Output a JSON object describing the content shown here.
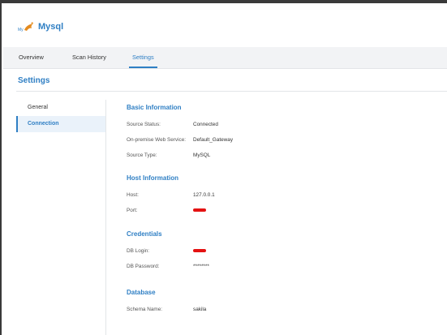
{
  "app": {
    "title": "Mysql",
    "logo_icon": "mysql-dolphin-logo-icon",
    "accent": "#2f7fc4"
  },
  "tabs": [
    {
      "label": "Overview",
      "active": false
    },
    {
      "label": "Scan History",
      "active": false
    },
    {
      "label": "Settings",
      "active": true
    }
  ],
  "page": {
    "title": "Settings"
  },
  "sidebar": {
    "items": [
      {
        "label": "General",
        "active": false
      },
      {
        "label": "Connection",
        "active": true
      }
    ]
  },
  "sections": {
    "basic": {
      "title": "Basic Information",
      "rows": [
        {
          "label": "Source Status:",
          "value": "Connected"
        },
        {
          "label": "On-premise Web Service:",
          "value": "Default_Gateway"
        },
        {
          "label": "Source Type:",
          "value": "MySQL"
        }
      ]
    },
    "host": {
      "title": "Host Information",
      "rows": [
        {
          "label": "Host:",
          "value": "127.0.0.1"
        },
        {
          "label": "Port:",
          "value": ""
        }
      ]
    },
    "credentials": {
      "title": "Credentials",
      "rows": [
        {
          "label": "DB Login:",
          "value": ""
        },
        {
          "label": "DB Password:",
          "value": "********"
        }
      ]
    },
    "database": {
      "title": "Database",
      "rows": [
        {
          "label": "Schema Name:",
          "value": "sakila"
        }
      ]
    }
  },
  "redaction_color": "#e41212"
}
